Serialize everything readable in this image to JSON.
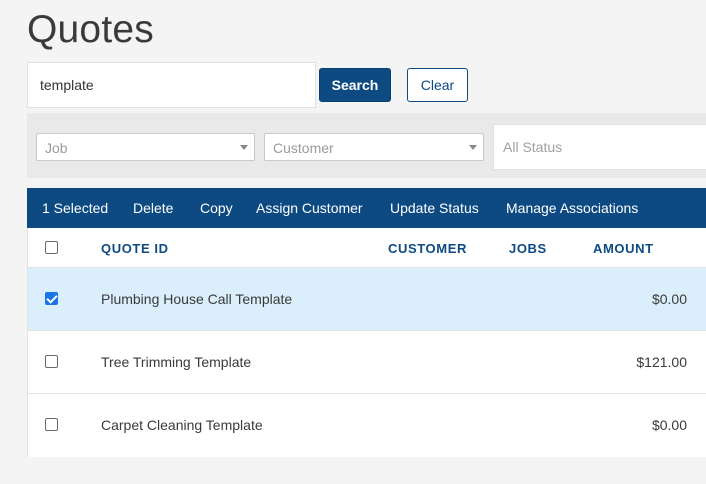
{
  "page": {
    "title": "Quotes"
  },
  "search": {
    "value": "template",
    "search_label": "Search",
    "clear_label": "Clear"
  },
  "filters": {
    "job_placeholder": "Job",
    "customer_placeholder": "Customer",
    "status_placeholder": "All Status"
  },
  "actions": {
    "selected_label": "1 Selected",
    "items": [
      "Delete",
      "Copy",
      "Assign Customer",
      "Update Status",
      "Manage Associations"
    ]
  },
  "table": {
    "columns": [
      "QUOTE ID",
      "CUSTOMER",
      "JOBS",
      "AMOUNT"
    ],
    "rows": [
      {
        "name": "Plumbing House Call Template",
        "customer": "",
        "jobs": "",
        "amount": "$0.00",
        "checked": true
      },
      {
        "name": "Tree Trimming Template",
        "customer": "",
        "jobs": "",
        "amount": "$121.00",
        "checked": false
      },
      {
        "name": "Carpet Cleaning Template",
        "customer": "",
        "jobs": "",
        "amount": "$0.00",
        "checked": false
      }
    ]
  },
  "colors": {
    "primary": "#0d4a82",
    "selected_row": "#dbeefb",
    "checkbox_checked": "#1a73e8"
  }
}
